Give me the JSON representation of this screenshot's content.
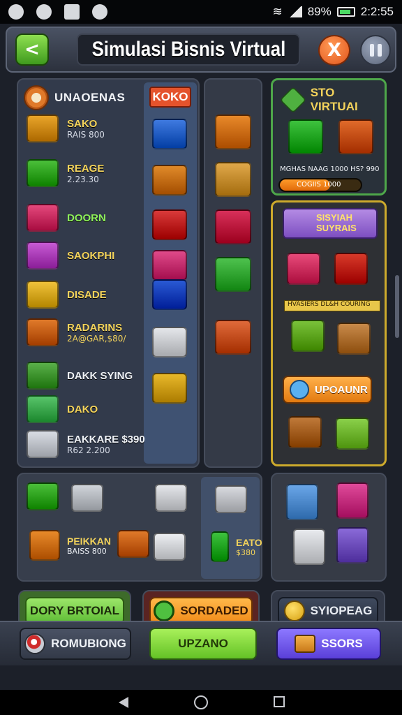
{
  "status_bar": {
    "battery_percent": "89%",
    "time": "2:2:55"
  },
  "header": {
    "title": "Simulasi Bisnis Virtual",
    "back_symbol": "<",
    "close_symbol": "X"
  },
  "shop": {
    "title": "UNAOENAS",
    "tag": "KOKO",
    "items": [
      {
        "name": "SAKO",
        "sub": "RAIS 800",
        "icon": "delivery-truck-icon",
        "color": "#e9a52a"
      },
      {
        "name": "REAGE",
        "sub": "2.23.30",
        "icon": "green-van-icon",
        "color": "#4bbf3a"
      },
      {
        "name": "DOORN",
        "sub": "",
        "icon": "pink-car-icon",
        "color": "#e4487c"
      },
      {
        "name": "SAOKPHI",
        "sub": "",
        "icon": "market-stall-icon",
        "color": "#c75ad4"
      },
      {
        "name": "DISADE",
        "sub": "",
        "icon": "register-icon",
        "color": "#f0c23a"
      },
      {
        "name": "RADARINS",
        "sub": "2A@GAR,$80/",
        "icon": "shop-booth-icon",
        "color": "#e07a2a"
      },
      {
        "name": "DAKK SYING",
        "sub": "",
        "icon": "cash-stack-icon",
        "color": "#5ab04a"
      },
      {
        "name": "DAKO",
        "sub": "",
        "icon": "card-icon",
        "color": "#58c46a"
      },
      {
        "name": "EAKKARE $390",
        "sub": "R62 2.200",
        "icon": "food-truck-icon",
        "color": "#d9dde4"
      }
    ],
    "side_icons": [
      {
        "icon": "shopping-cart-icon",
        "color": "#3f7ae0"
      },
      {
        "icon": "cardboard-box-icon",
        "color": "#e08a2a"
      },
      {
        "icon": "red-kiosk-icon",
        "color": "#d93a3a"
      },
      {
        "icon": "pink-stall-icon",
        "color": "#e04a8a"
      },
      {
        "icon": "blue-store-icon",
        "color": "#2a5ad4"
      },
      {
        "icon": "white-crate-icon",
        "color": "#e4e6ea"
      },
      {
        "icon": "yellow-van-icon",
        "color": "#e8b82a"
      }
    ]
  },
  "middle_column": [
    {
      "icon": "orange-crate-icon",
      "color": "#e8892a"
    },
    {
      "icon": "food-basket-icon",
      "color": "#e0a84a"
    },
    {
      "icon": "red-sofa-icon",
      "color": "#d8305a"
    },
    {
      "icon": "green-chair-icon",
      "color": "#4ec24e"
    },
    {
      "icon": "market-counter-icon",
      "color": "#e06a3a"
    }
  ],
  "store": {
    "title": "STO VIRTUAI",
    "info_line": "MGHAS NAAG 1000 HS? 990",
    "progress_label": "COGIIS 1000",
    "progress": 0.62,
    "icons": [
      {
        "icon": "cash-bundle-icon",
        "color": "#3ec23e"
      },
      {
        "icon": "orange-cabinet-icon",
        "color": "#e06a2a"
      }
    ]
  },
  "special": {
    "title": "SISYIAH\nSUYRAIS",
    "ribbon": "HVASIERS DL&H COURING",
    "upgrade_label": "UPOAUNR",
    "icons": [
      {
        "icon": "produce-stand-icon",
        "color": "#e84a7a"
      },
      {
        "icon": "red-armchair-icon",
        "color": "#d83a2a"
      },
      {
        "icon": "fruit-crate-icon",
        "color": "#7ac23a"
      },
      {
        "icon": "brown-box-icon",
        "color": "#c98a4a"
      },
      {
        "icon": "cardboard-box-icon",
        "color": "#c07a3a"
      },
      {
        "icon": "plant-pot-icon",
        "color": "#8ad04a"
      }
    ]
  },
  "inventory": {
    "items": [
      {
        "name": "PEIKKAN",
        "sub": "BAISS 800",
        "icon": "orange-box-icon",
        "color": "#e88a2a"
      },
      {
        "name": "EATO",
        "sub": "$380",
        "icon": "green-can-icon",
        "color": "#3ec23e"
      }
    ],
    "icons": [
      {
        "icon": "green-truck-icon",
        "color": "#4bbf3a"
      },
      {
        "icon": "silver-car-icon",
        "color": "#d0d4da"
      },
      {
        "icon": "white-crate-icon",
        "color": "#e4e6ea"
      },
      {
        "icon": "orange-kiosk-icon",
        "color": "#e07a2a"
      },
      {
        "icon": "white-van-icon",
        "color": "#eceef2"
      },
      {
        "icon": "appliance-icon",
        "color": "#d8dadf"
      }
    ],
    "decor_icons": [
      {
        "icon": "gift-box-icon",
        "color": "#6aa6e8"
      },
      {
        "icon": "pink-sofa-icon",
        "color": "#e04a9a"
      },
      {
        "icon": "white-cube-icon",
        "color": "#e8eaee"
      },
      {
        "icon": "purple-fridge-icon",
        "color": "#8a6ad8"
      }
    ]
  },
  "actions": {
    "primary": "DORY BRTOIAL",
    "secondary": "SORDADED",
    "tertiary": "SYIOPEAG"
  },
  "bottom_nav": {
    "left": "ROMUBIONG",
    "center": "UPZANO",
    "right": "SSORS"
  }
}
